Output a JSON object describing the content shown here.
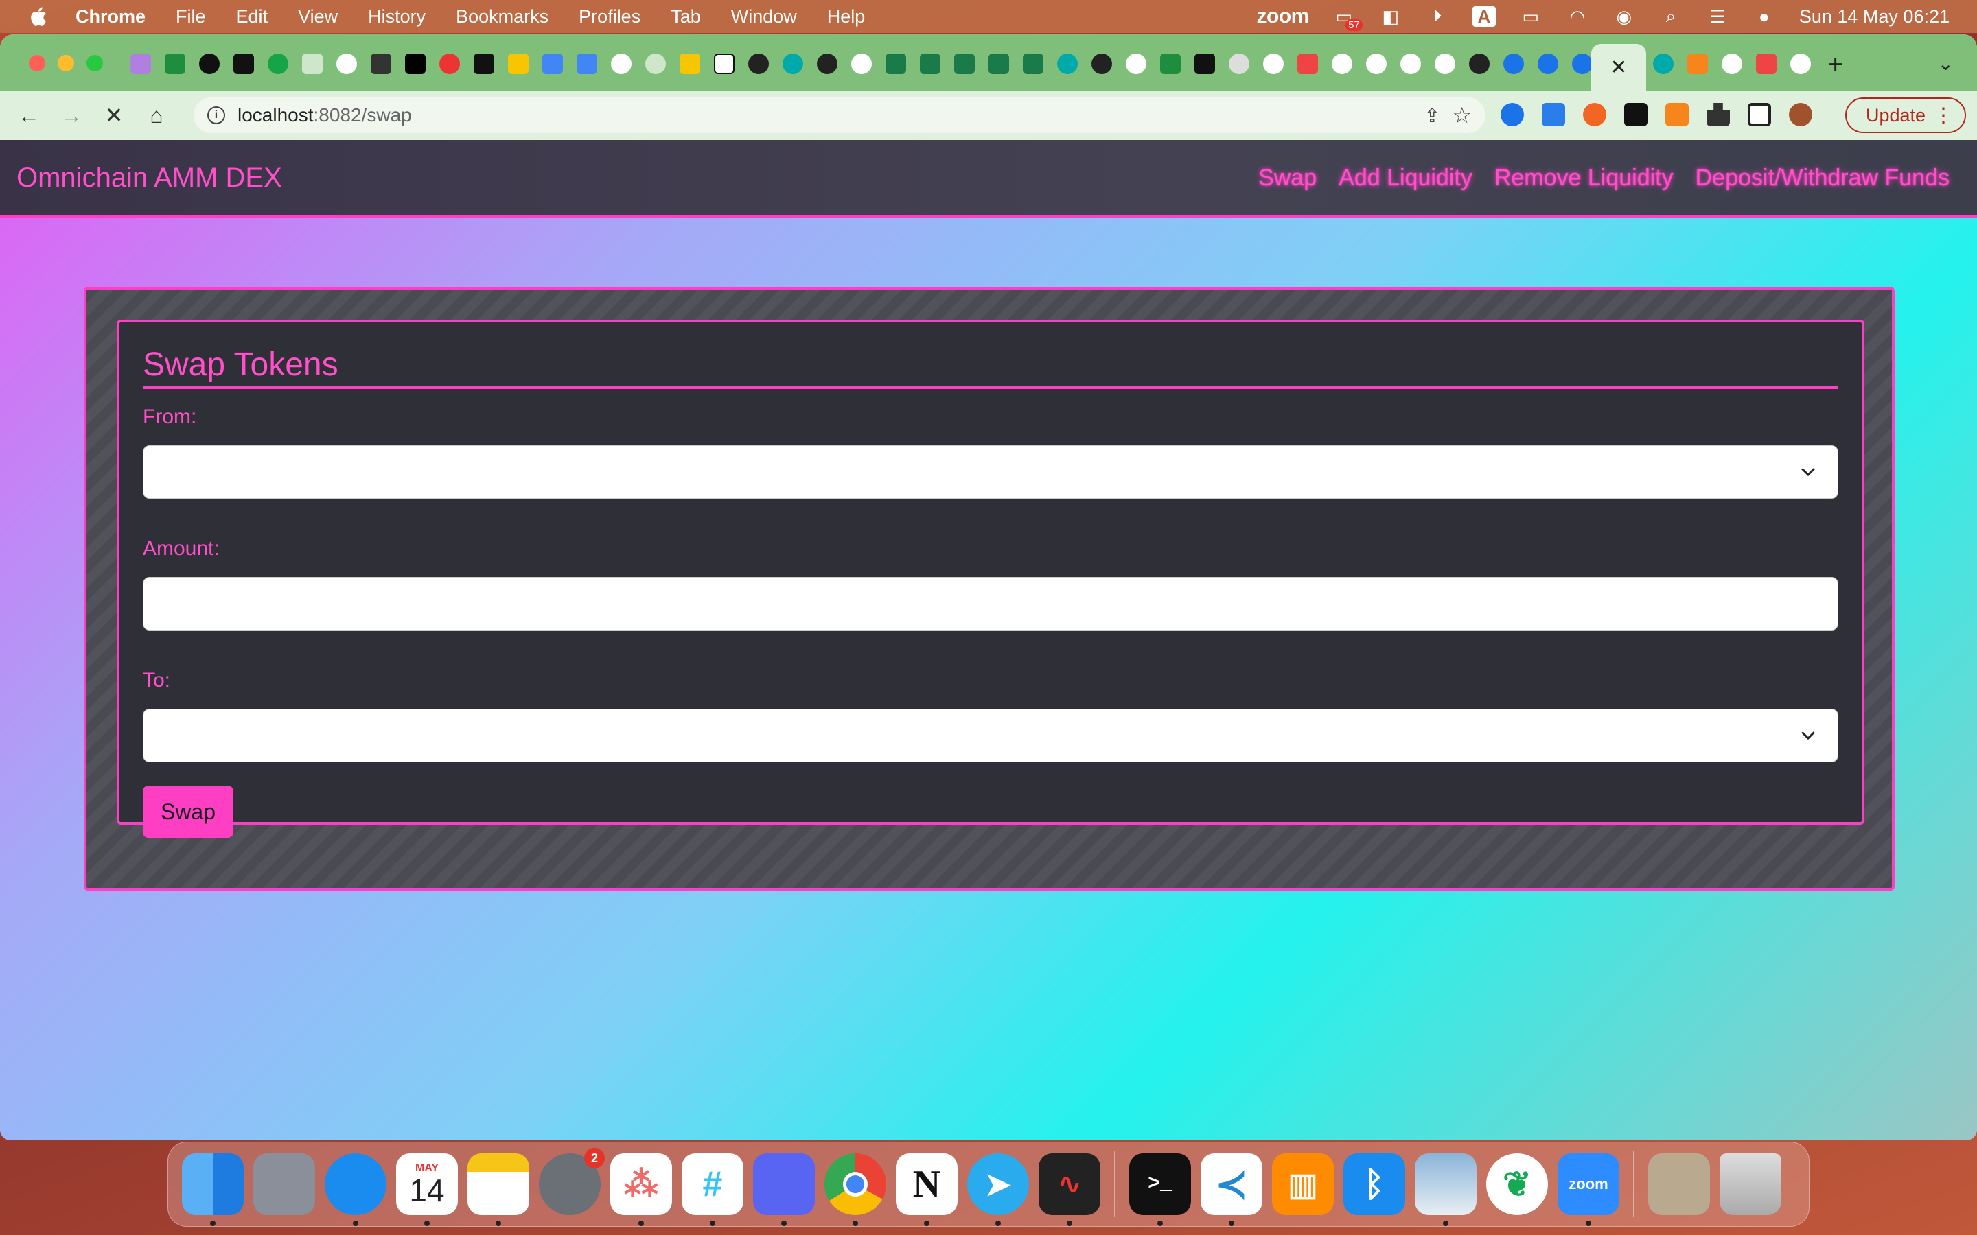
{
  "menubar": {
    "app_name": "Chrome",
    "items": [
      "File",
      "Edit",
      "View",
      "History",
      "Bookmarks",
      "Profiles",
      "Tab",
      "Window",
      "Help"
    ],
    "zoom_label": "zoom",
    "notif_count": "57",
    "keyboard_label": "A",
    "datetime": "Sun 14 May  06:21"
  },
  "browser": {
    "url_host": "localhost",
    "url_rest": ":8082/swap",
    "update_label": "Update",
    "active_tab_close": "✕"
  },
  "page": {
    "brand": "Omnichain AMM DEX",
    "nav_links": [
      "Swap",
      "Add Liquidity",
      "Remove Liquidity",
      "Deposit/Withdraw Funds"
    ],
    "card_title": "Swap Tokens",
    "from_label": "From:",
    "amount_label": "Amount:",
    "to_label": "To:",
    "from_value": "",
    "amount_value": "",
    "to_value": "",
    "swap_button": "Swap"
  },
  "dock": {
    "calendar_month": "MAY",
    "calendar_day": "14",
    "settings_badge": "2",
    "zoom_label": "zoom"
  },
  "colors": {
    "accent": "#ff3fc3",
    "accent_text": "#ff4fc9",
    "card_bg": "#2f2f37",
    "tabstrip": "#7fbf7a"
  }
}
